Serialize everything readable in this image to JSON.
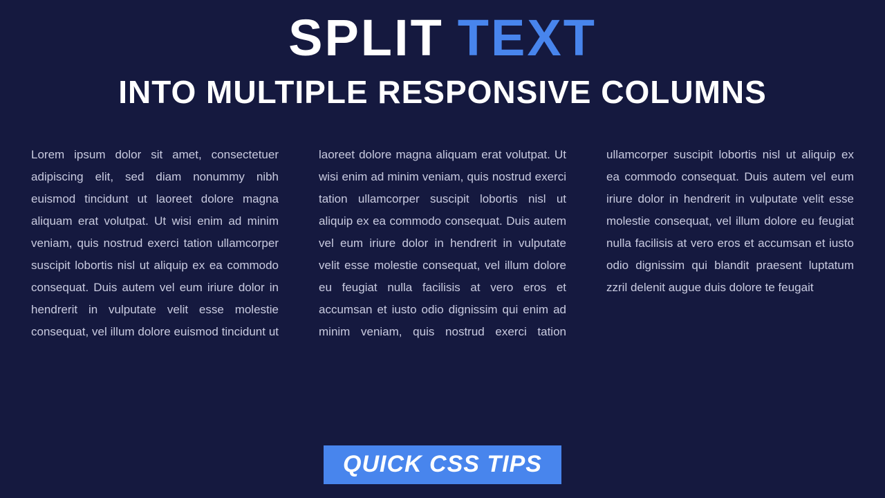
{
  "title": {
    "word1": "SPLIT",
    "word2": "TEXT"
  },
  "subtitle": "INTO MULTIPLE RESPONSIVE COLUMNS",
  "body_text": "Lorem ipsum dolor sit amet, consectetuer adipiscing elit, sed diam nonummy nibh euismod tincidunt ut laoreet dolore magna aliquam erat volutpat. Ut wisi enim ad minim veniam, quis nostrud exerci tation ullamcorper suscipit lobortis nisl ut aliquip ex ea commodo consequat. Duis autem vel eum iriure dolor in hendrerit in vulputate velit esse molestie consequat, vel illum dolore euismod tincidunt ut laoreet dolore magna aliquam erat volutpat. Ut wisi enim ad minim veniam, quis nostrud exerci tation ullamcorper suscipit lobortis nisl ut aliquip ex ea commodo consequat. Duis autem vel eum iriure dolor in hendrerit in vulputate velit esse molestie consequat, vel illum dolore eu feugiat nulla facilisis at vero eros et accumsan et iusto odio dignissim qui enim ad minim veniam, quis nostrud exerci tation ullamcorper suscipit lobortis nisl ut aliquip ex ea commodo consequat. Duis autem vel eum iriure dolor in hendrerit in vulputate velit esse molestie consequat, vel illum dolore eu feugiat nulla facilisis at vero eros et accumsan et iusto odio dignissim qui blandit praesent luptatum zzril delenit augue duis dolore te feugait",
  "badge": "QUICK CSS TIPS",
  "colors": {
    "bg": "#15193f",
    "accent": "#4885ed",
    "text": "#c9cbe0"
  }
}
